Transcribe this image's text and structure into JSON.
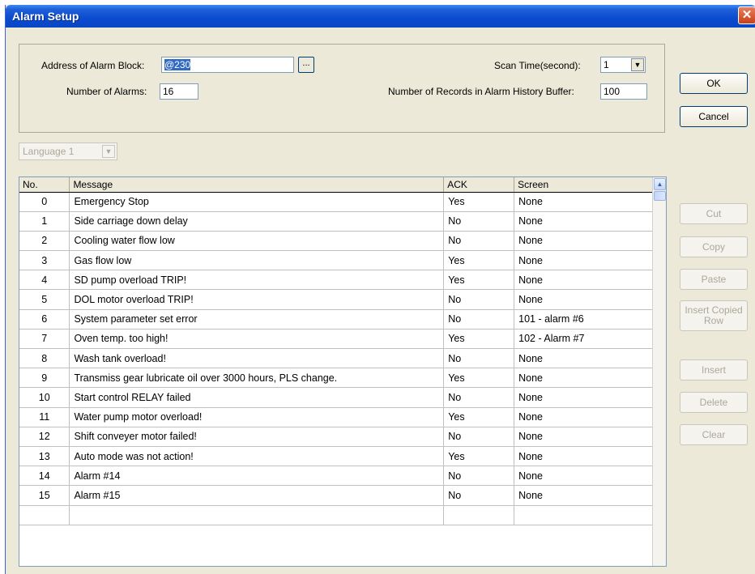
{
  "window": {
    "title": "Alarm Setup",
    "close_glyph": "✕"
  },
  "settings": {
    "address_label": "Address of Alarm Block:",
    "address_value": "@230",
    "browse_label": "...",
    "num_alarms_label": "Number of Alarms:",
    "num_alarms_value": "16",
    "scan_time_label": "Scan Time(second):",
    "scan_time_value": "1",
    "history_label": "Number of Records in Alarm History Buffer:",
    "history_value": "100"
  },
  "buttons": {
    "ok": "OK",
    "cancel": "Cancel",
    "cut": "Cut",
    "copy": "Copy",
    "paste": "Paste",
    "insert_copied_row": "Insert Copied Row",
    "insert": "Insert",
    "delete": "Delete",
    "clear": "Clear"
  },
  "language": {
    "selected": "Language 1"
  },
  "table": {
    "columns": [
      "No.",
      "Message",
      "ACK",
      "Screen"
    ],
    "rows": [
      {
        "no": "0",
        "message": "Emergency Stop",
        "ack": "Yes",
        "screen": "None"
      },
      {
        "no": "1",
        "message": "Side carriage down delay",
        "ack": "No",
        "screen": "None"
      },
      {
        "no": "2",
        "message": "Cooling water flow low",
        "ack": "No",
        "screen": "None"
      },
      {
        "no": "3",
        "message": "Gas flow low",
        "ack": "Yes",
        "screen": "None"
      },
      {
        "no": "4",
        "message": "SD pump overload TRIP!",
        "ack": "Yes",
        "screen": "None"
      },
      {
        "no": "5",
        "message": "DOL motor overload TRIP!",
        "ack": "No",
        "screen": "None"
      },
      {
        "no": "6",
        "message": "System parameter set error",
        "ack": "No",
        "screen": "101 - alarm #6"
      },
      {
        "no": "7",
        "message": "Oven temp. too high!",
        "ack": "Yes",
        "screen": "102 - Alarm #7"
      },
      {
        "no": "8",
        "message": "Wash tank overload!",
        "ack": "No",
        "screen": "None"
      },
      {
        "no": "9",
        "message": "Transmiss gear lubricate oil over 3000 hours, PLS change.",
        "ack": "Yes",
        "screen": "None"
      },
      {
        "no": "10",
        "message": "Start control RELAY failed",
        "ack": "No",
        "screen": "None"
      },
      {
        "no": "11",
        "message": "Water pump motor overload!",
        "ack": "Yes",
        "screen": "None"
      },
      {
        "no": "12",
        "message": "Shift conveyer motor failed!",
        "ack": "No",
        "screen": "None"
      },
      {
        "no": "13",
        "message": "Auto mode was not action!",
        "ack": "Yes",
        "screen": "None"
      },
      {
        "no": "14",
        "message": "Alarm #14",
        "ack": "No",
        "screen": "None"
      },
      {
        "no": "15",
        "message": "Alarm #15",
        "ack": "No",
        "screen": "None"
      },
      {
        "no": "",
        "message": "",
        "ack": "",
        "screen": ""
      }
    ]
  },
  "icons": {
    "dropdown": "chevron-down-icon",
    "scroll_up": "arrow-up-icon",
    "close": "close-icon"
  }
}
